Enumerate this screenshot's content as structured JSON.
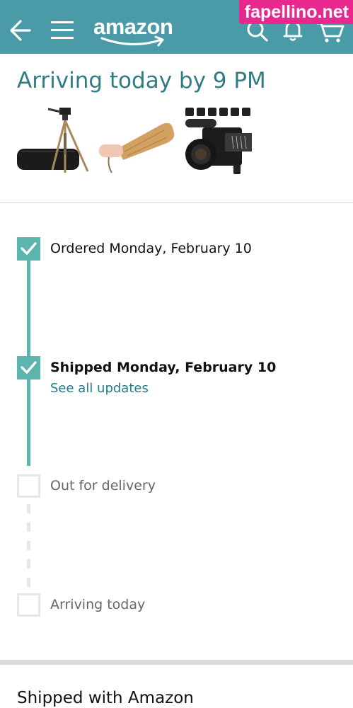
{
  "header": {
    "logo_text": "amazon",
    "back_icon": "back-arrow-icon",
    "menu_icon": "hamburger-menu-icon",
    "search_icon": "search-icon",
    "notifications_icon": "bell-icon",
    "cart_icon": "cart-icon",
    "background_color": "#4a9aa8"
  },
  "watermark": "fapellino.net",
  "delivery": {
    "heading": "Arriving today by 9 PM",
    "products": [
      "tripod",
      "wooden paddle",
      "4K camcorder"
    ]
  },
  "tracking": {
    "steps": [
      {
        "label": "Ordered Monday, February 10",
        "status": "complete"
      },
      {
        "label": "Shipped Monday, February 10",
        "status": "complete",
        "link": "See all updates"
      },
      {
        "label": "Out for delivery",
        "status": "pending"
      },
      {
        "label": "Arriving today",
        "status": "pending"
      }
    ],
    "accent_color": "#5bb5ad"
  },
  "shipping": {
    "title": "Shipped with Amazon"
  }
}
